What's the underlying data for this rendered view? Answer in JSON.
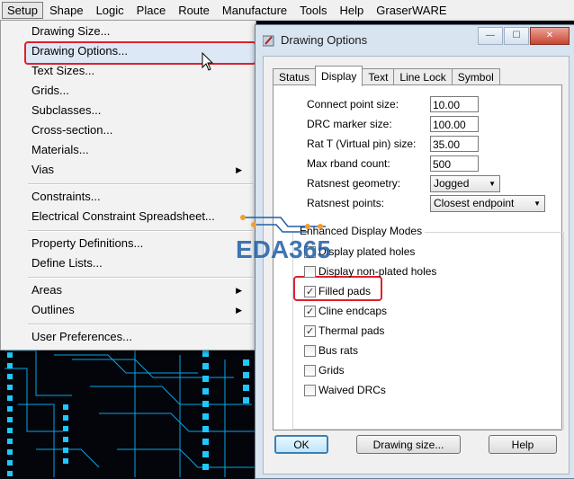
{
  "menubar": {
    "items": [
      "Setup",
      "Shape",
      "Logic",
      "Place",
      "Route",
      "Manufacture",
      "Tools",
      "Help",
      "GraserWARE"
    ]
  },
  "setup_menu": {
    "items": [
      "Drawing Size...",
      "Drawing Options...",
      "Text Sizes...",
      "Grids...",
      "Subclasses...",
      "Cross-section...",
      "Materials...",
      "Vias",
      "Constraints...",
      "Electrical Constraint Spreadsheet...",
      "Property Definitions...",
      "Define Lists...",
      "Areas",
      "Outlines",
      "User Preferences..."
    ],
    "submenu_arrow": "▶"
  },
  "dialog": {
    "title": "Drawing Options",
    "tabs": [
      "Status",
      "Display",
      "Text",
      "Line Lock",
      "Symbol"
    ],
    "active_tab": "Display",
    "fields": {
      "connect_point_label": "Connect point size:",
      "connect_point_value": "10.00",
      "drc_marker_label": "DRC marker size:",
      "drc_marker_value": "100.00",
      "rat_t_label": "Rat T (Virtual pin) size:",
      "rat_t_value": "35.00",
      "max_rband_label": "Max rband count:",
      "max_rband_value": "500",
      "ratsnest_geometry_label": "Ratsnest geometry:",
      "ratsnest_geometry_value": "Jogged",
      "ratsnest_points_label": "Ratsnest points:",
      "ratsnest_points_value": "Closest endpoint"
    },
    "group_title": "Enhanced Display Modes",
    "checkboxes": [
      {
        "label": "Display plated holes",
        "checked": false
      },
      {
        "label": "Display non-plated holes",
        "checked": false
      },
      {
        "label": "Filled pads",
        "checked": true
      },
      {
        "label": "Cline endcaps",
        "checked": true
      },
      {
        "label": "Thermal pads",
        "checked": true
      },
      {
        "label": "Bus rats",
        "checked": false
      },
      {
        "label": "Grids",
        "checked": false
      },
      {
        "label": "Waived DRCs",
        "checked": false
      }
    ],
    "buttons": {
      "ok": "OK",
      "drawing_size": "Drawing size...",
      "help": "Help"
    },
    "title_buttons": {
      "minimize": "—",
      "maximize": "☐",
      "close": "✕"
    }
  },
  "watermark": "EDA365",
  "colors": {
    "highlight": "#e0202a",
    "pcb_trace": "#00b4f0",
    "pcb_background": "#04050a",
    "dialog_frame": "#d8e4f0"
  }
}
